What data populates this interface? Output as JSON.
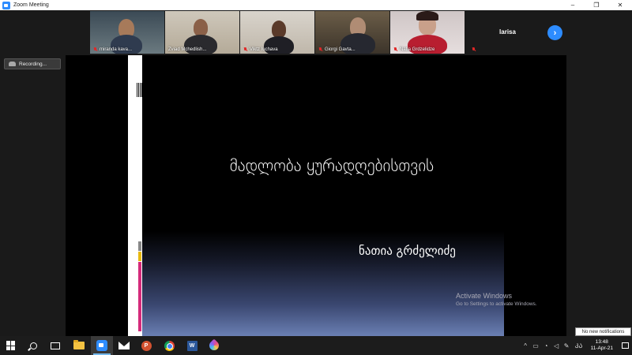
{
  "window": {
    "title": "Zoom Meeting",
    "controls": [
      "–",
      "❐",
      "✕"
    ]
  },
  "gallery": {
    "participants": [
      {
        "name": "miranda kava...",
        "muted": true
      },
      {
        "name": "Zviad Mchedlish...",
        "muted": false
      },
      {
        "name": "Viktz Iuchava",
        "muted": true
      },
      {
        "name": "Giorgi Gavta...",
        "muted": true
      },
      {
        "name": "Natia Grdzelidze",
        "muted": true
      }
    ],
    "name_only_participant": "larisa",
    "next_button": "›"
  },
  "recording": {
    "label": "Recording..."
  },
  "slide": {
    "title": "მადლობა  ყურადღებისთვის",
    "author": "ნათია გრძელიძე"
  },
  "watermark": {
    "title": "Activate Windows",
    "subtitle": "Go to Settings to activate Windows."
  },
  "toast": {
    "text": "No new notifications"
  },
  "taskbar": {
    "apps": [
      "start-icon",
      "search-icon",
      "task-view-icon",
      "file-explorer-icon",
      "zoom-icon",
      "mail-icon",
      "powerpoint-icon",
      "chrome-icon",
      "word-icon",
      "paint-icon"
    ],
    "ppt_letter": "P",
    "word_letter": "W",
    "tray": {
      "chevron": "^",
      "language": "ᲙᲐ",
      "time": "13:48",
      "date": "11-Apr-21"
    }
  }
}
